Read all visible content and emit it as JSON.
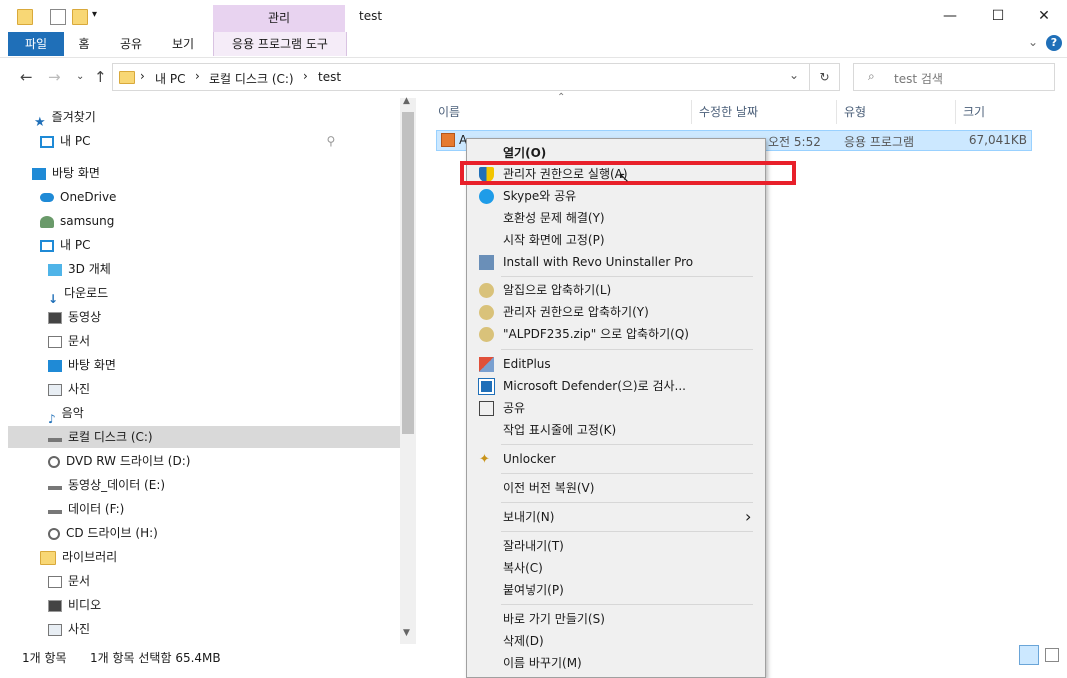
{
  "window": {
    "title": "test",
    "context_tab_group": "관리",
    "controls": {
      "minimize": "—",
      "maximize": "☐",
      "close": "✕"
    }
  },
  "ribbon": {
    "tabs": [
      "파일",
      "홈",
      "공유",
      "보기",
      "응용 프로그램 도구"
    ]
  },
  "address": {
    "crumbs": [
      "내 PC",
      "로컬 디스크 (C:)",
      "test"
    ],
    "sep": "›",
    "search_placeholder": "test 검색"
  },
  "nav": {
    "items": [
      {
        "label": "즐겨찾기",
        "icon": "star-icon"
      },
      {
        "label": "내 PC",
        "icon": "monitor-icon"
      },
      {
        "label": "바탕 화면",
        "icon": "desktop-icon"
      },
      {
        "label": "OneDrive",
        "icon": "cloud-icon"
      },
      {
        "label": "samsung",
        "icon": "user-icon"
      },
      {
        "label": "내 PC",
        "icon": "monitor-icon"
      },
      {
        "label": "3D 개체",
        "icon": "cube-icon"
      },
      {
        "label": "다운로드",
        "icon": "download-icon"
      },
      {
        "label": "동영상",
        "icon": "film-icon"
      },
      {
        "label": "문서",
        "icon": "document-icon"
      },
      {
        "label": "바탕 화면",
        "icon": "desktop-icon"
      },
      {
        "label": "사진",
        "icon": "picture-icon"
      },
      {
        "label": "음악",
        "icon": "music-icon"
      },
      {
        "label": "로컬 디스크 (C:)",
        "icon": "drive-icon"
      },
      {
        "label": "DVD RW 드라이브 (D:)",
        "icon": "disc-icon"
      },
      {
        "label": "동영상_데이터 (E:)",
        "icon": "drive-icon"
      },
      {
        "label": "데이터 (F:)",
        "icon": "drive-icon"
      },
      {
        "label": "CD 드라이브 (H:)",
        "icon": "disc-icon"
      },
      {
        "label": "라이브러리",
        "icon": "library-icon"
      },
      {
        "label": "문서",
        "icon": "document-icon"
      },
      {
        "label": "비디오",
        "icon": "film-icon"
      },
      {
        "label": "사진",
        "icon": "picture-icon"
      }
    ]
  },
  "files": {
    "columns": [
      "이름",
      "수정한 날짜",
      "유형",
      "크기"
    ],
    "rows": [
      {
        "name": "A",
        "modified": "오전 5:52",
        "type": "응용 프로그램",
        "size": "67,041KB"
      }
    ]
  },
  "status": {
    "count": "1개 항목",
    "selection": "1개 항목 선택함 65.4MB"
  },
  "context_menu": {
    "items": [
      {
        "label": "열기(O)",
        "icon": ""
      },
      {
        "label": "관리자 권한으로 실행(A)",
        "icon": "shield-icon"
      },
      {
        "label": "Skype와 공유",
        "icon": "skype-icon"
      },
      {
        "label": "호환성 문제 해결(Y)",
        "icon": ""
      },
      {
        "label": "시작 화면에 고정(P)",
        "icon": ""
      },
      {
        "label": "Install with Revo Uninstaller Pro",
        "icon": "revo-icon"
      },
      {
        "label": "알집으로 압축하기(L)",
        "icon": "alzip-icon"
      },
      {
        "label": "관리자 권한으로 압축하기(Y)",
        "icon": "alzip-icon"
      },
      {
        "label": "\"ALPDF235.zip\" 으로 압축하기(Q)",
        "icon": "alzip-icon"
      },
      {
        "label": "EditPlus",
        "icon": "editplus-icon"
      },
      {
        "label": "Microsoft Defender(으)로 검사...",
        "icon": "defender-icon"
      },
      {
        "label": "공유",
        "icon": "share-icon"
      },
      {
        "label": "작업 표시줄에 고정(K)",
        "icon": ""
      },
      {
        "label": "Unlocker",
        "icon": "wand-icon"
      },
      {
        "label": "이전 버전 복원(V)",
        "icon": ""
      },
      {
        "label": "보내기(N)",
        "icon": ""
      },
      {
        "label": "잘라내기(T)",
        "icon": ""
      },
      {
        "label": "복사(C)",
        "icon": ""
      },
      {
        "label": "붙여넣기(P)",
        "icon": ""
      },
      {
        "label": "바로 가기 만들기(S)",
        "icon": ""
      },
      {
        "label": "삭제(D)",
        "icon": ""
      },
      {
        "label": "이름 바꾸기(M)",
        "icon": ""
      }
    ],
    "submenu_arrow": "›"
  },
  "colors": {
    "accent": "#1f6fb8",
    "selection": "#cce8ff",
    "highlight_box": "#e8202a",
    "context_tab": "#e8d3f0"
  }
}
